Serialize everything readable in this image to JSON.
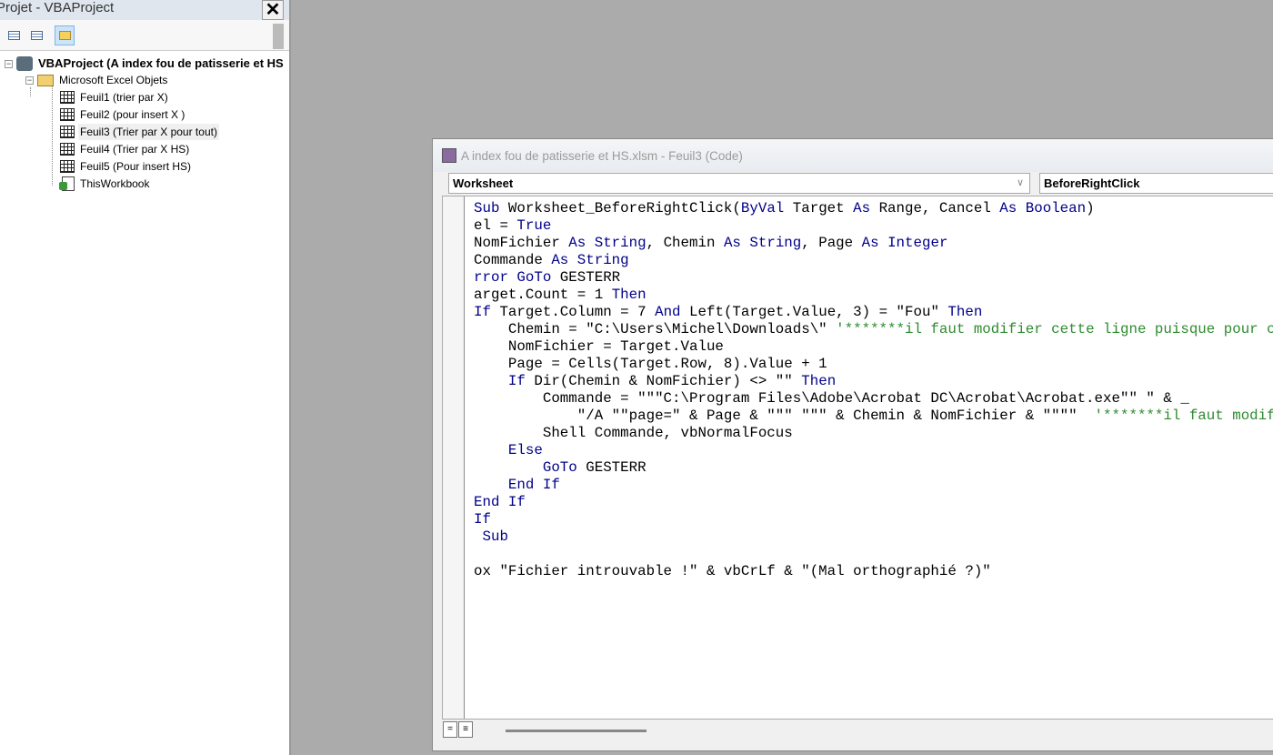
{
  "project": {
    "title": "Projet - VBAProject",
    "close": "✕",
    "tree": {
      "root": "VBAProject (A index fou de patisserie et HS",
      "folder": "Microsoft Excel Objets",
      "items": [
        "Feuil1 (trier par X)",
        "Feuil2 (pour insert X )",
        "Feuil3 (Trier par X pour tout)",
        "Feuil4 (Trier par X  HS)",
        "Feuil5 (Pour insert HS)",
        "ThisWorkbook"
      ]
    }
  },
  "code_window": {
    "title": "A index fou de patisserie et HS.xlsm - Feuil3 (Code)",
    "object": "Worksheet",
    "procedure": "BeforeRightClick",
    "lines": [
      [
        [
          "k",
          "Sub "
        ],
        [
          "t",
          "Worksheet_BeforeRightClick("
        ],
        [
          "k",
          "ByVal"
        ],
        [
          "t",
          " Target "
        ],
        [
          "k",
          "As"
        ],
        [
          "t",
          " Range, Cancel "
        ],
        [
          "k",
          "As"
        ],
        [
          "t",
          " "
        ],
        [
          "k",
          "Boolean"
        ],
        [
          "t",
          ")"
        ]
      ],
      [
        [
          "t",
          "el = "
        ],
        [
          "k",
          "True"
        ]
      ],
      [
        [
          "t",
          "NomFichier "
        ],
        [
          "k",
          "As String"
        ],
        [
          "t",
          ", Chemin "
        ],
        [
          "k",
          "As String"
        ],
        [
          "t",
          ", Page "
        ],
        [
          "k",
          "As Integer"
        ]
      ],
      [
        [
          "t",
          "Commande "
        ],
        [
          "k",
          "As String"
        ]
      ],
      [
        [
          "k",
          "rror GoTo"
        ],
        [
          "t",
          " GESTERR"
        ]
      ],
      [
        [
          "t",
          "arget.Count = 1 "
        ],
        [
          "k",
          "Then"
        ]
      ],
      [
        [
          "k",
          "If"
        ],
        [
          "t",
          " Target.Column = 7 "
        ],
        [
          "k",
          "And"
        ],
        [
          "t",
          " Left(Target.Value, 3) = \"Fou\" "
        ],
        [
          "k",
          "Then"
        ]
      ],
      [
        [
          "t",
          "    Chemin = \"C:\\Users\\Michel\\Downloads\\\" "
        ],
        [
          "c",
          "'*******il faut modifier cette ligne puisque pour c"
        ]
      ],
      [
        [
          "t",
          "    NomFichier = Target.Value"
        ]
      ],
      [
        [
          "t",
          "    Page = Cells(Target.Row, 8).Value + 1"
        ]
      ],
      [
        [
          "t",
          "    "
        ],
        [
          "k",
          "If"
        ],
        [
          "t",
          " Dir(Chemin & NomFichier) <> \"\" "
        ],
        [
          "k",
          "Then"
        ]
      ],
      [
        [
          "t",
          "        Commande = \"\"\"C:\\Program Files\\Adobe\\Acrobat DC\\Acrobat\\Acrobat.exe\"\" \" & _"
        ]
      ],
      [
        [
          "t",
          "            \"/A \"\"page=\" & Page & \"\"\" \"\"\" & Chemin & NomFichier & \"\"\"\"  "
        ],
        [
          "c",
          "'*******il faut modif"
        ]
      ],
      [
        [
          "t",
          "        Shell Commande, vbNormalFocus"
        ]
      ],
      [
        [
          "t",
          "    "
        ],
        [
          "k",
          "Else"
        ]
      ],
      [
        [
          "t",
          "        "
        ],
        [
          "k",
          "GoTo"
        ],
        [
          "t",
          " GESTERR"
        ]
      ],
      [
        [
          "t",
          "    "
        ],
        [
          "k",
          "End If"
        ]
      ],
      [
        [
          "k",
          "End If"
        ]
      ],
      [
        [
          "k",
          "If"
        ]
      ],
      [
        [
          "t",
          " "
        ],
        [
          "k",
          "Sub"
        ]
      ],
      [
        [
          "t",
          ""
        ]
      ],
      [
        [
          "t",
          "ox \"Fichier introuvable !\" & vbCrLf & \"(Mal orthographié ?)\""
        ]
      ]
    ]
  }
}
